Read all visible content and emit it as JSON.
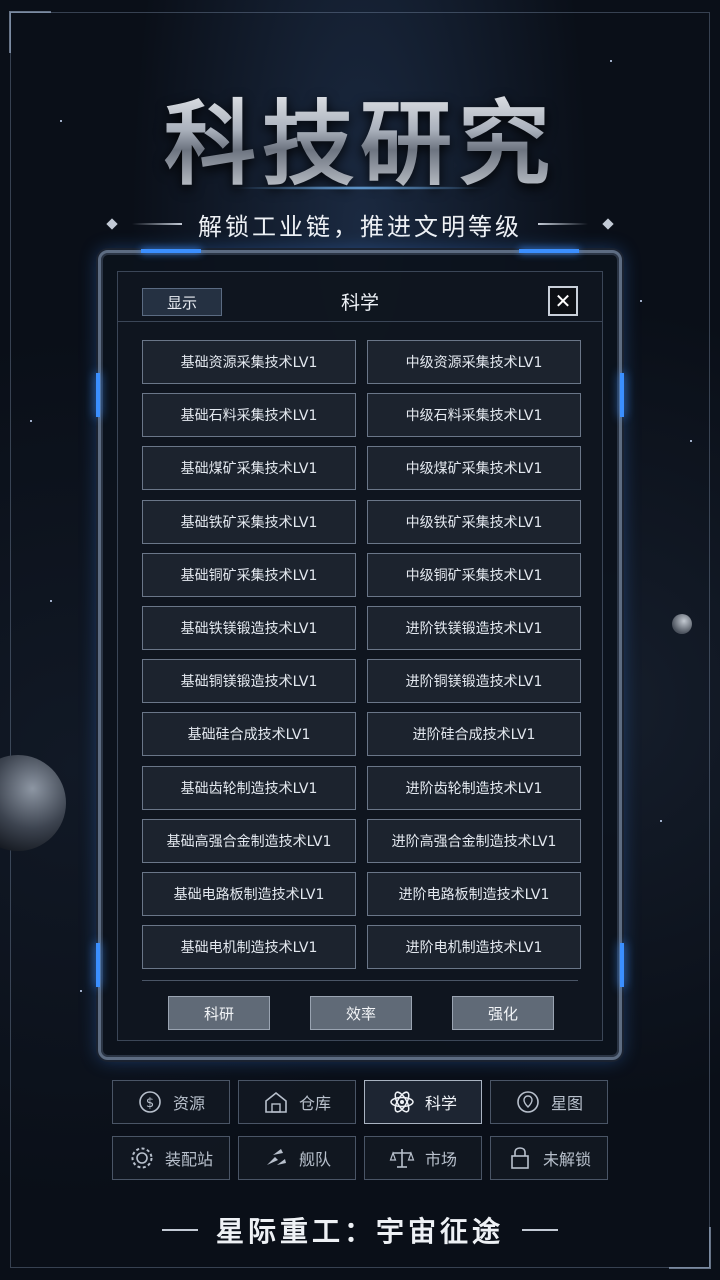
{
  "title": "科技研究",
  "subtitle": "解锁工业链，推进文明等级",
  "panel": {
    "show_label": "显示",
    "title": "科学",
    "close_glyph": "✕",
    "tech_rows": [
      {
        "left": "基础资源采集技术LV1",
        "right": "中级资源采集技术LV1"
      },
      {
        "left": "基础石料采集技术LV1",
        "right": "中级石料采集技术LV1"
      },
      {
        "left": "基础煤矿采集技术LV1",
        "right": "中级煤矿采集技术LV1"
      },
      {
        "left": "基础铁矿采集技术LV1",
        "right": "中级铁矿采集技术LV1"
      },
      {
        "left": "基础铜矿采集技术LV1",
        "right": "中级铜矿采集技术LV1"
      },
      {
        "left": "基础铁镁锻造技术LV1",
        "right": "进阶铁镁锻造技术LV1"
      },
      {
        "left": "基础铜镁锻造技术LV1",
        "right": "进阶铜镁锻造技术LV1"
      },
      {
        "left": "基础硅合成技术LV1",
        "right": "进阶硅合成技术LV1"
      },
      {
        "left": "基础齿轮制造技术LV1",
        "right": "进阶齿轮制造技术LV1"
      },
      {
        "left": "基础高强合金制造技术LV1",
        "right": "进阶高强合金制造技术LV1"
      },
      {
        "left": "基础电路板制造技术LV1",
        "right": "进阶电路板制造技术LV1"
      },
      {
        "left": "基础电机制造技术LV1",
        "right": "进阶电机制造技术LV1"
      }
    ],
    "bottom_buttons": [
      "科研",
      "效率",
      "强化"
    ]
  },
  "nav": {
    "row1": [
      {
        "label": "资源",
        "icon": "coin-leaf-icon",
        "active": false
      },
      {
        "label": "仓库",
        "icon": "warehouse-icon",
        "active": false
      },
      {
        "label": "科学",
        "icon": "atom-icon",
        "active": true
      },
      {
        "label": "星图",
        "icon": "planet-pin-icon",
        "active": false
      }
    ],
    "row2": [
      {
        "label": "装配站",
        "icon": "gear-wrench-icon",
        "active": false
      },
      {
        "label": "舰队",
        "icon": "fleet-icon",
        "active": false
      },
      {
        "label": "市场",
        "icon": "scales-icon",
        "active": false
      },
      {
        "label": "未解锁",
        "icon": "lock-icon",
        "active": false
      }
    ]
  },
  "footer_title": "星际重工：宇宙征途",
  "colors": {
    "background": "#0a0f18",
    "panel_border": "#5d6c82",
    "accent_glow": "#3b8fff",
    "tech_button_bg": "#1c232e",
    "bottom_button_bg": "#606a77"
  }
}
